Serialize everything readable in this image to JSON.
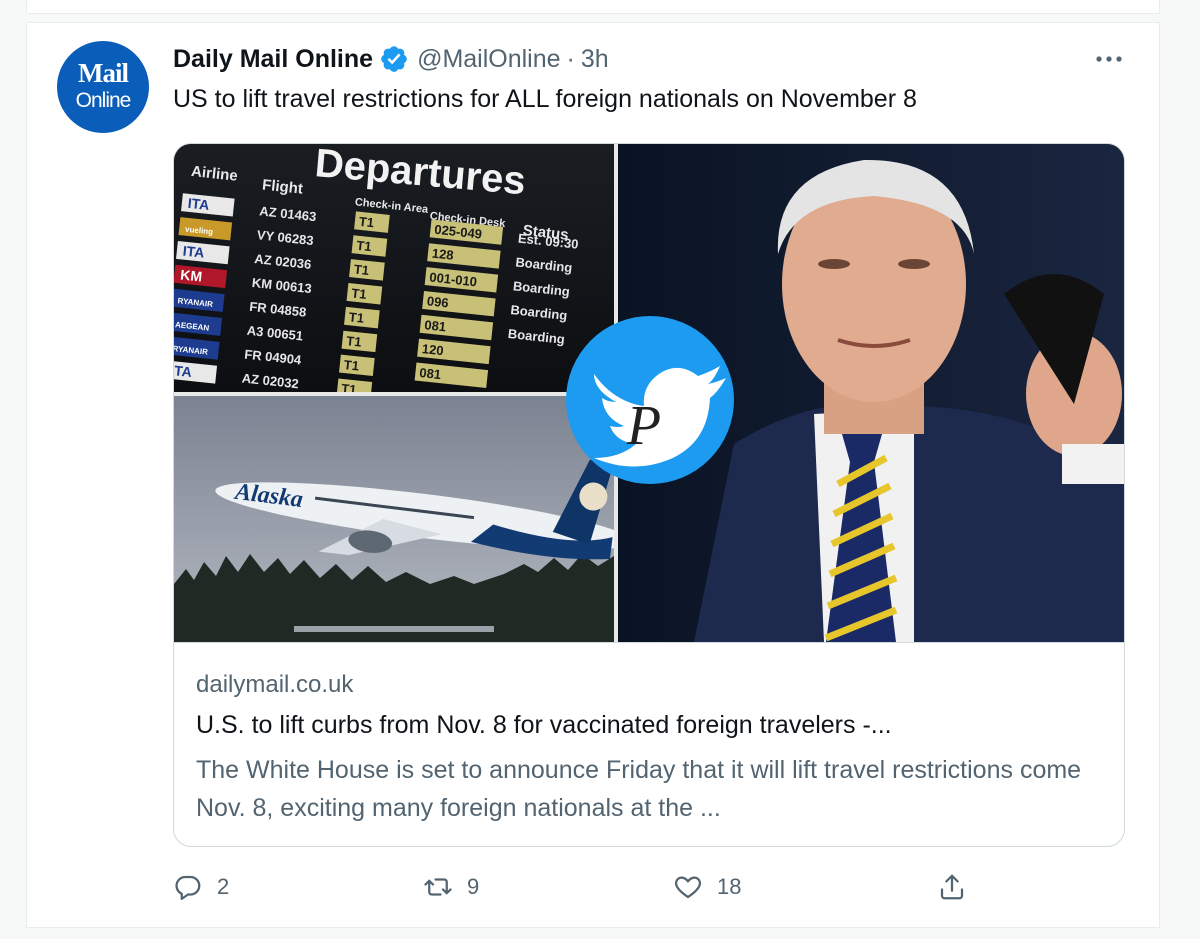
{
  "tweet": {
    "author_name": "Daily Mail Online",
    "handle": "@MailOnline",
    "separator": "·",
    "time": "3h",
    "text": "US to lift travel restrictions for ALL foreign nationals on November 8",
    "avatar": {
      "line1": "Mail",
      "line2": "Online",
      "bg_color": "#0a5db8"
    },
    "verified_color": "#1d9bf0"
  },
  "media": {
    "board": {
      "heading": "Departures",
      "columns": [
        "Airline",
        "Flight",
        "Check-in Area",
        "Check-in Desk",
        "Status"
      ],
      "rows": [
        {
          "airline": "ITA",
          "flight": "AZ 01463",
          "area": "T1",
          "desk": "025-049",
          "status": "Est. 09:30"
        },
        {
          "airline": "vueling",
          "flight": "VY 06283",
          "area": "T1",
          "desk": "128",
          "status": "Boarding"
        },
        {
          "airline": "ITA",
          "flight": "AZ 02036",
          "area": "T1",
          "desk": "001-010",
          "status": "Boarding"
        },
        {
          "airline": "KM",
          "flight": "KM 00613",
          "area": "T1",
          "desk": "096",
          "status": "Boarding"
        },
        {
          "airline": "RYANAIR",
          "flight": "FR 04858",
          "area": "T1",
          "desk": "081",
          "status": "Boarding"
        },
        {
          "airline": "AEGEAN",
          "flight": "A3 00651",
          "area": "T1",
          "desk": "120",
          "status": ""
        },
        {
          "airline": "RYANAIR",
          "flight": "FR 04904",
          "area": "T1",
          "desk": "081",
          "status": ""
        },
        {
          "airline": "ITA",
          "flight": "AZ 02032",
          "area": "T1",
          "desk": "",
          "status": ""
        }
      ]
    },
    "plane_livery": "Alaska",
    "watermark_letter": "P"
  },
  "card": {
    "domain": "dailymail.co.uk",
    "title": "U.S. to lift curbs from Nov. 8 for vaccinated foreign travelers -...",
    "description": "The White House is set to announce Friday that it will lift travel restrictions come Nov. 8, exciting many foreign nationals at the ..."
  },
  "actions": {
    "reply_count": "2",
    "retweet_count": "9",
    "like_count": "18"
  }
}
